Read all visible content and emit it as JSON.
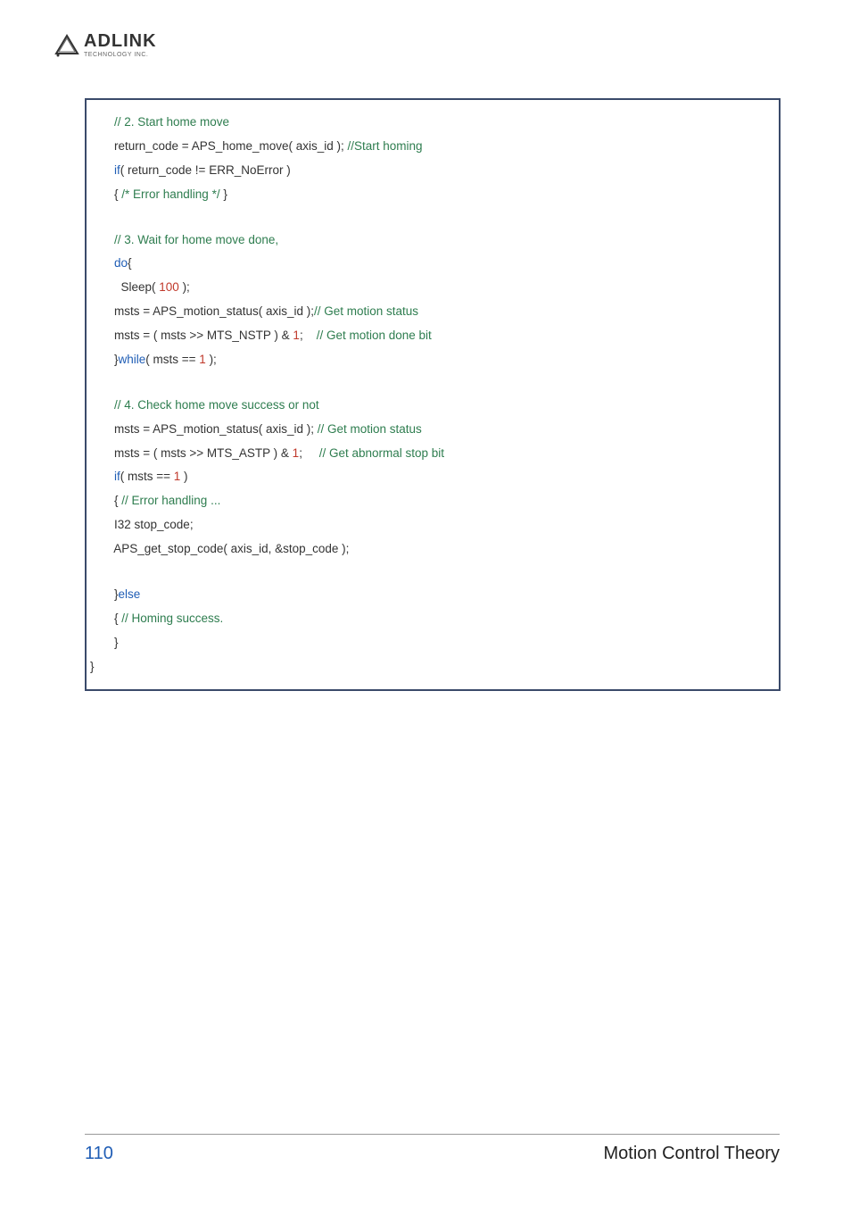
{
  "logo": {
    "brand": "ADLINK",
    "sub": "TECHNOLOGY INC."
  },
  "code": {
    "l01_a": "    ",
    "l01_b": "// 2. Start home move",
    "l02_a": "    return_code = APS_home_move( axis_id ); ",
    "l02_b": "//Start homing",
    "l03_a": "    ",
    "l03_b": "if",
    "l03_c": "( return_code != ERR_NoError )",
    "l04_a": "    { ",
    "l04_b": "/* Error handling */",
    "l04_c": " }",
    "l05_a": "    ",
    "l05_b": "// 3. Wait for home move done,",
    "l06_a": "    ",
    "l06_b": "do",
    "l06_c": "{",
    "l07_a": "      Sleep( ",
    "l07_b": "100",
    "l07_c": " );",
    "l08_a": "    msts = APS_motion_status( axis_id );",
    "l08_b": "// Get motion status",
    "l09_a": "    msts = ( msts >> MTS_NSTP ) & ",
    "l09_b": "1",
    "l09_c": ";    ",
    "l09_d": "// Get motion done bit",
    "l10_a": "    }",
    "l10_b": "while",
    "l10_c": "( msts == ",
    "l10_d": "1",
    "l10_e": " );",
    "l11_a": "    ",
    "l11_b": "// 4. Check home move success or not",
    "l12_a": "    msts = APS_motion_status( axis_id ); ",
    "l12_b": "// Get motion status",
    "l13_a": "    msts = ( msts >> MTS_ASTP ) & ",
    "l13_b": "1",
    "l13_c": ";     ",
    "l13_d": "// Get abnormal stop bit",
    "l14_a": "    ",
    "l14_b": "if",
    "l14_c": "( msts == ",
    "l14_d": "1",
    "l14_e": " )",
    "l15_a": "    { ",
    "l15_b": "// Error handling ...",
    "l16": "    I32 stop_code;",
    "l17": "    APS_get_stop_code( axis_id, &stop_code );",
    "l18_a": "    }",
    "l18_b": "else",
    "l19_a": "    { ",
    "l19_b": "// Homing success.",
    "l20": "    }",
    "l21": "}"
  },
  "footer": {
    "page": "110",
    "title": "Motion Control Theory"
  }
}
